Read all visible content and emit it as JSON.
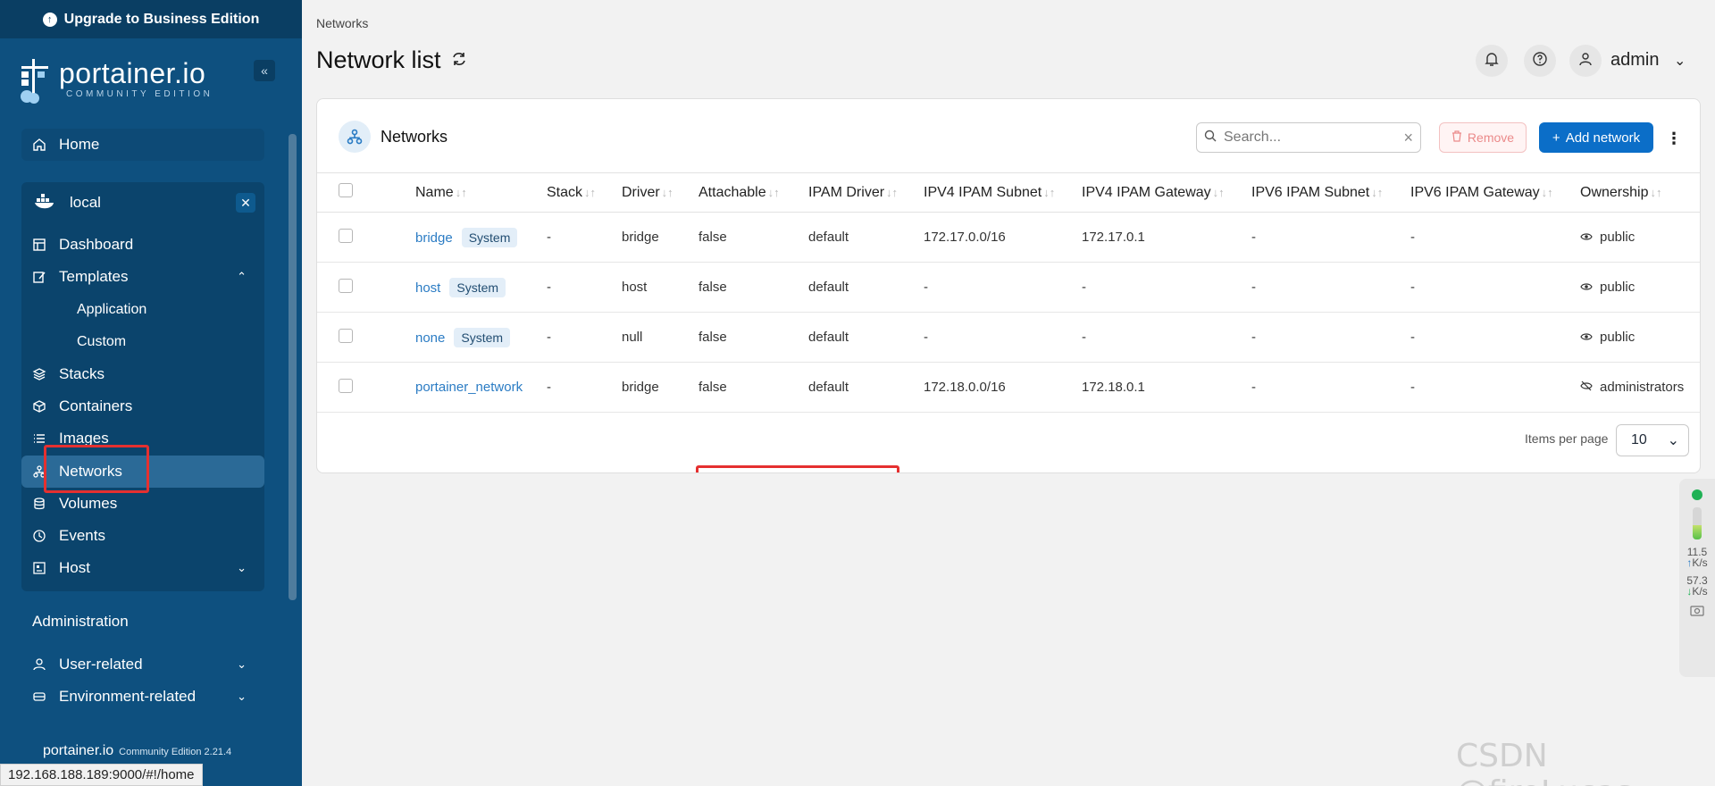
{
  "sidebar": {
    "upgrade_label": "Upgrade to Business Edition",
    "brand": "portainer.io",
    "edition": "COMMUNITY EDITION",
    "home": "Home",
    "environment": "local",
    "items": [
      {
        "label": "Dashboard",
        "icon": "dashboard-icon"
      },
      {
        "label": "Templates",
        "icon": "templates-icon"
      },
      {
        "label": "Application",
        "icon": ""
      },
      {
        "label": "Custom",
        "icon": ""
      },
      {
        "label": "Stacks",
        "icon": "stacks-icon"
      },
      {
        "label": "Containers",
        "icon": "containers-icon"
      },
      {
        "label": "Images",
        "icon": "images-icon"
      },
      {
        "label": "Networks",
        "icon": "networks-icon"
      },
      {
        "label": "Volumes",
        "icon": "volumes-icon"
      },
      {
        "label": "Events",
        "icon": "events-icon"
      },
      {
        "label": "Host",
        "icon": "host-icon"
      }
    ],
    "administration": "Administration",
    "user_related": "User-related",
    "environment_related": "Environment-related",
    "footer_brand": "portainer.io",
    "footer_version": "Community Edition 2.21.4"
  },
  "status_url": "192.168.188.189:9000/#!/home",
  "header": {
    "breadcrumb": "Networks",
    "title": "Network list",
    "user": "admin"
  },
  "card": {
    "title": "Networks",
    "search_placeholder": "Search...",
    "remove_label": "Remove",
    "add_label": "Add network",
    "columns": [
      "Name",
      "Stack",
      "Driver",
      "Attachable",
      "IPAM Driver",
      "IPV4 IPAM Subnet",
      "IPV4 IPAM Gateway",
      "IPV6 IPAM Subnet",
      "IPV6 IPAM Gateway",
      "Ownership"
    ],
    "rows": [
      {
        "name": "bridge",
        "badge": "System",
        "stack": "-",
        "driver": "bridge",
        "attachable": "false",
        "ipam_driver": "default",
        "ipv4_subnet": "172.17.0.0/16",
        "ipv4_gateway": "172.17.0.1",
        "ipv6_subnet": "-",
        "ipv6_gateway": "-",
        "ownership": "public"
      },
      {
        "name": "host",
        "badge": "System",
        "stack": "-",
        "driver": "host",
        "attachable": "false",
        "ipam_driver": "default",
        "ipv4_subnet": "-",
        "ipv4_gateway": "-",
        "ipv6_subnet": "-",
        "ipv6_gateway": "-",
        "ownership": "public"
      },
      {
        "name": "none",
        "badge": "System",
        "stack": "-",
        "driver": "null",
        "attachable": "false",
        "ipam_driver": "default",
        "ipv4_subnet": "-",
        "ipv4_gateway": "-",
        "ipv6_subnet": "-",
        "ipv6_gateway": "-",
        "ownership": "public"
      },
      {
        "name": "portainer_network",
        "badge": "",
        "stack": "-",
        "driver": "bridge",
        "attachable": "false",
        "ipam_driver": "default",
        "ipv4_subnet": "172.18.0.0/16",
        "ipv4_gateway": "172.18.0.1",
        "ipv6_subnet": "-",
        "ipv6_gateway": "-",
        "ownership": "administrators"
      }
    ],
    "items_per_page_label": "Items per page",
    "items_per_page": "10"
  },
  "widget": {
    "up_value": "11.5",
    "up_unit": "K/s",
    "down_value": "57.3",
    "down_unit": "K/s"
  },
  "watermark": "CSDN @fireLucas",
  "colors": {
    "sidebar": "#0e507f",
    "accent": "#0b6ec8",
    "highlight": "#e53030"
  }
}
